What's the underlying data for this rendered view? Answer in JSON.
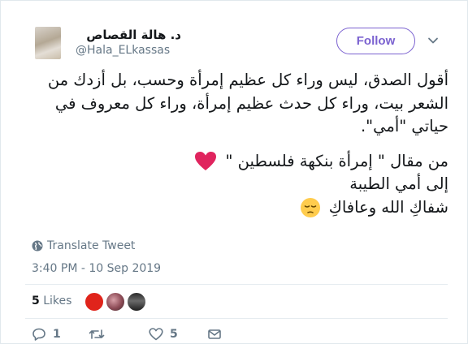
{
  "user": {
    "name": "د. هالة القصاص",
    "handle": "@Hala_ELkassas"
  },
  "follow_label": "Follow",
  "tweet": {
    "paragraph1": [
      "أقول الصدق، ليس وراء كل  عظيم إمرأة وحسب، بل أزدك من",
      "الشعر بيت، وراء كل حدث عظيم إمرأة، وراء كل معروف في",
      "حياتي \"أمي\"."
    ],
    "paragraph2": [
      "من مقال \" إمرأة بنكهة فلسطين \"",
      "إلى أمي الطيبة",
      "شفاكِ الله وعافاكِ"
    ]
  },
  "translate_label": "Translate Tweet",
  "timestamp": "3:40 PM - 10 Sep 2019",
  "likes": {
    "count": "5",
    "label": "Likes"
  },
  "actions": {
    "replies": "1",
    "retweets": "",
    "likes": "5"
  },
  "colors": {
    "follow_accent": "#7b62d0",
    "heart": "#e0245e",
    "meta": "#657786"
  }
}
